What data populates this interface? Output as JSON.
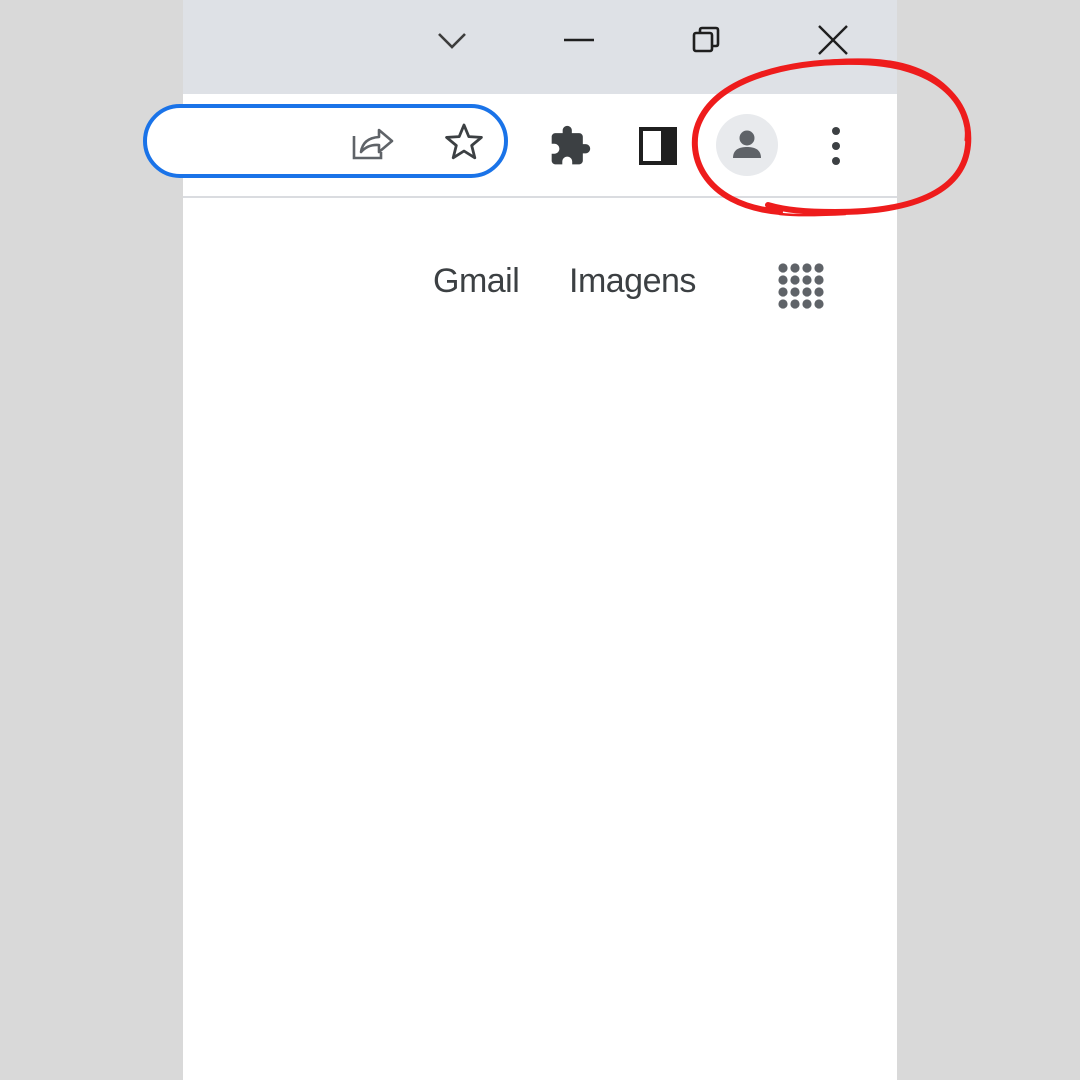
{
  "window_controls": {
    "tab_search_icon": "chevron-down-icon",
    "minimize_icon": "minimize-icon",
    "restore_icon": "restore-icon",
    "close_icon": "close-icon"
  },
  "toolbar": {
    "share_icon": "share-icon",
    "bookmark_icon": "star-icon",
    "extensions_icon": "puzzle-icon",
    "side_panel_icon": "side-panel-icon",
    "profile_icon": "person-icon",
    "menu_icon": "three-dot-menu-icon"
  },
  "page": {
    "gmail_label": "Gmail",
    "images_label": "Imagens",
    "apps_icon": "apps-grid-icon"
  },
  "colors": {
    "accent": "#1a73e8",
    "highlight": "#ee1c1c",
    "titlebar": "#dee1e6",
    "backdrop": "#d9d9d9"
  }
}
